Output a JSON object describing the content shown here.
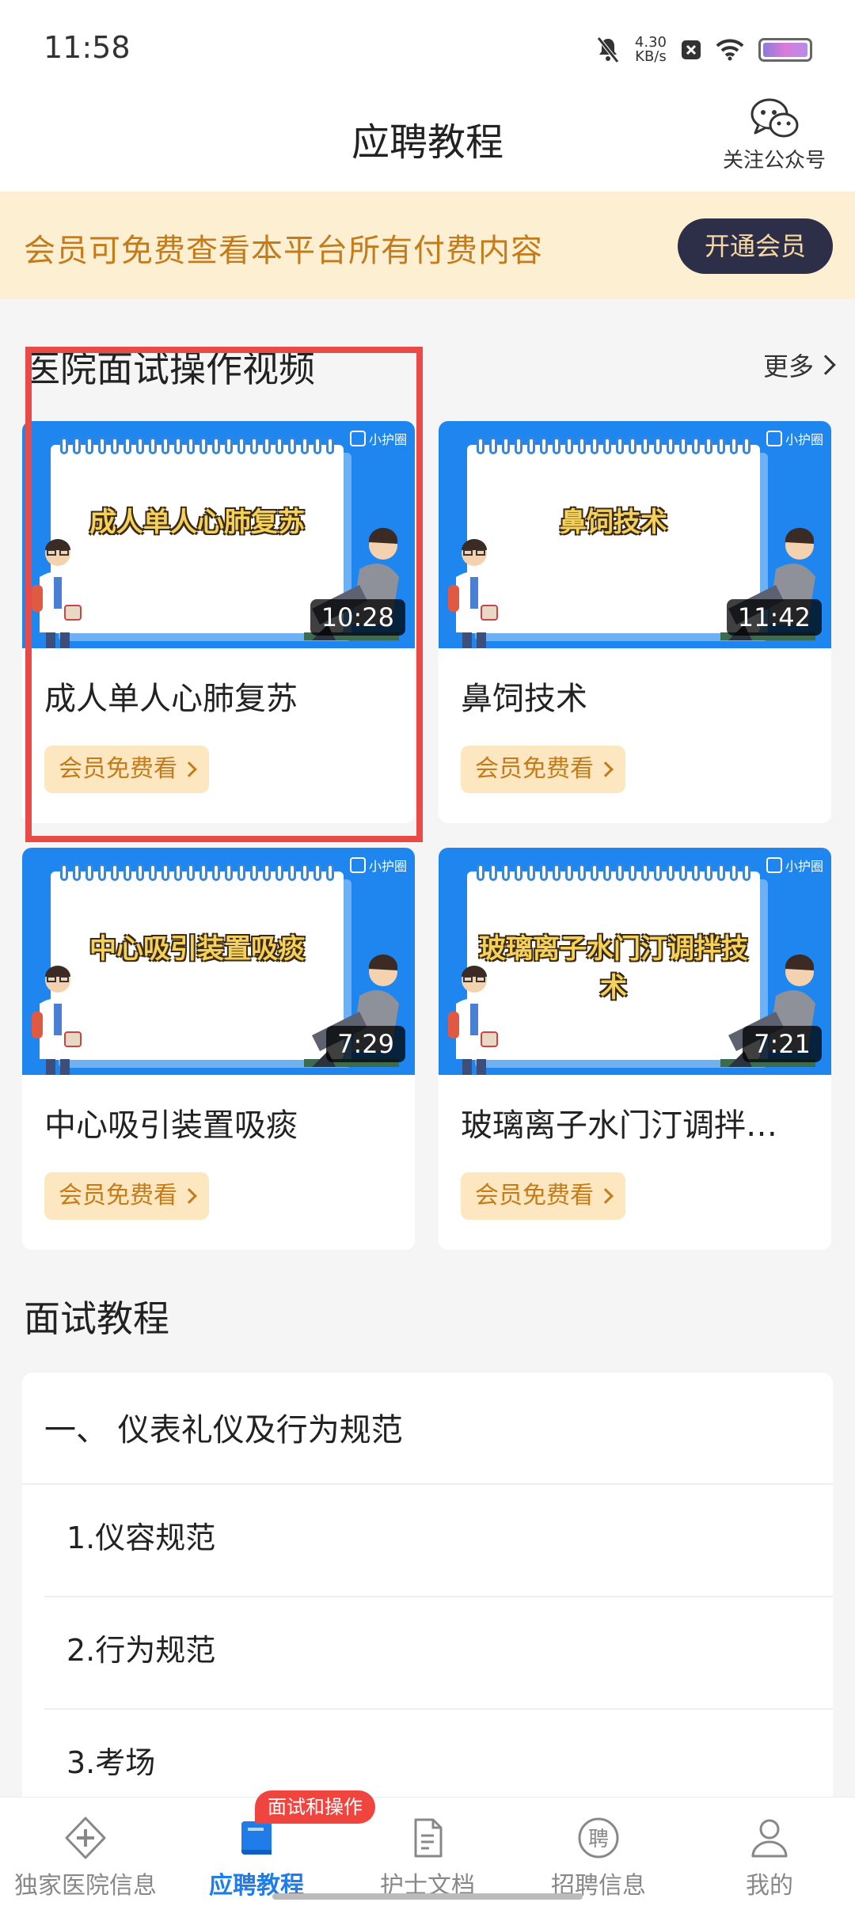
{
  "status_bar": {
    "time": "11:58",
    "speed_value": "4.30",
    "speed_unit": "KB/s"
  },
  "header": {
    "title": "应聘教程",
    "follow_label": "关注公众号"
  },
  "banner": {
    "text": "会员可免费查看本平台所有付费内容",
    "button": "开通会员"
  },
  "videos": {
    "section_title": "医院面试操作视频",
    "more": "更多",
    "free_label": "会员免费看",
    "brand": "小护圈",
    "items": [
      {
        "title": "成人单人心肺复苏",
        "thumb_title": "成人单人心肺复苏",
        "duration": "10:28"
      },
      {
        "title": "鼻饲技术",
        "thumb_title": "鼻饲技术",
        "duration": "11:42"
      },
      {
        "title": "中心吸引装置吸痰",
        "thumb_title": "中心吸引装置吸痰",
        "duration": "7:29"
      },
      {
        "title": "玻璃离子水门汀调拌…",
        "thumb_title": "玻璃离子水门汀调拌技术",
        "duration": "7:21"
      }
    ]
  },
  "tutorials": {
    "section_title": "面试教程",
    "group_title": "一、 仪表礼仪及行为规范",
    "items": [
      "1.仪容规范",
      "2.行为规范",
      "3.考场"
    ]
  },
  "bottom_nav": {
    "badge": "面试和操作",
    "items": [
      {
        "label": "独家医院信息",
        "icon": "hospital-cross-icon"
      },
      {
        "label": "应聘教程",
        "icon": "book-icon"
      },
      {
        "label": "护士文档",
        "icon": "document-icon"
      },
      {
        "label": "招聘信息",
        "icon": "recruit-icon"
      },
      {
        "label": "我的",
        "icon": "user-icon"
      }
    ]
  },
  "colors": {
    "accent_blue": "#1f7ce8",
    "banner_bg": "#fdefd2",
    "banner_text": "#c47b1a",
    "highlight_red": "#e84a48",
    "badge_red": "#f0443f"
  }
}
